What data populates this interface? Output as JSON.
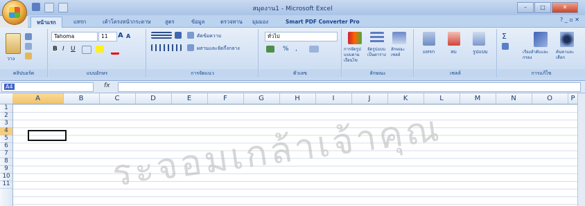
{
  "window": {
    "title": "สมุดงาน1 - Microsoft Excel",
    "min": "–",
    "max": "□",
    "close": "✕"
  },
  "tabs": [
    "หน้าแรก",
    "แทรก",
    "เค้าโครงหน้ากระดาษ",
    "สูตร",
    "ข้อมูล",
    "ตรวจทาน",
    "มุมมอง",
    "Smart PDF Converter Pro"
  ],
  "ribbon": {
    "clipboard": {
      "paste": "วาง",
      "label": "คลิปบอร์ด"
    },
    "font": {
      "name": "Tahoma",
      "size": "11",
      "grow": "A",
      "shrink": "A",
      "bold": "B",
      "italic": "I",
      "underline": "U",
      "label": "แบบอักษร"
    },
    "alignment": {
      "wrap": "ตัดข้อความ",
      "merge": "ผสานและจัดกึ่งกลาง",
      "label": "การจัดแนว"
    },
    "number": {
      "format": "ทั่วไป",
      "percent": "%",
      "comma": ",",
      "label": "ตัวเลข"
    },
    "styles": {
      "cond": "การจัดรูปแบบตามเงื่อนไข",
      "table": "จัดรูปแบบเป็นตาราง",
      "cell": "ลักษณะเซลล์",
      "label": "ลักษณะ"
    },
    "cells": {
      "insert": "แทรก",
      "delete": "ลบ",
      "format": "รูปแบบ",
      "label": "เซลล์"
    },
    "editing": {
      "sort": "เรียงลำดับและกรอง",
      "find": "ค้นหาและเลือก",
      "sigma": "Σ",
      "label": "การแก้ไข"
    }
  },
  "formula_bar": {
    "name_box": "A4",
    "fx": "fx",
    "value": ""
  },
  "columns": [
    "A",
    "B",
    "C",
    "D",
    "E",
    "F",
    "G",
    "H",
    "I",
    "J",
    "K",
    "L",
    "M",
    "N",
    "O",
    "P"
  ],
  "rows": [
    "1",
    "2",
    "3",
    "4",
    "5",
    "6",
    "7",
    "8",
    "9",
    "10",
    "11"
  ],
  "selected_cell": "A4",
  "watermark": "ระจอมเกล้าเจ้าคุณ",
  "colors": {
    "ribbon": "#c6d9f1",
    "accent": "#15428b",
    "selection": "#f4cd7d"
  }
}
